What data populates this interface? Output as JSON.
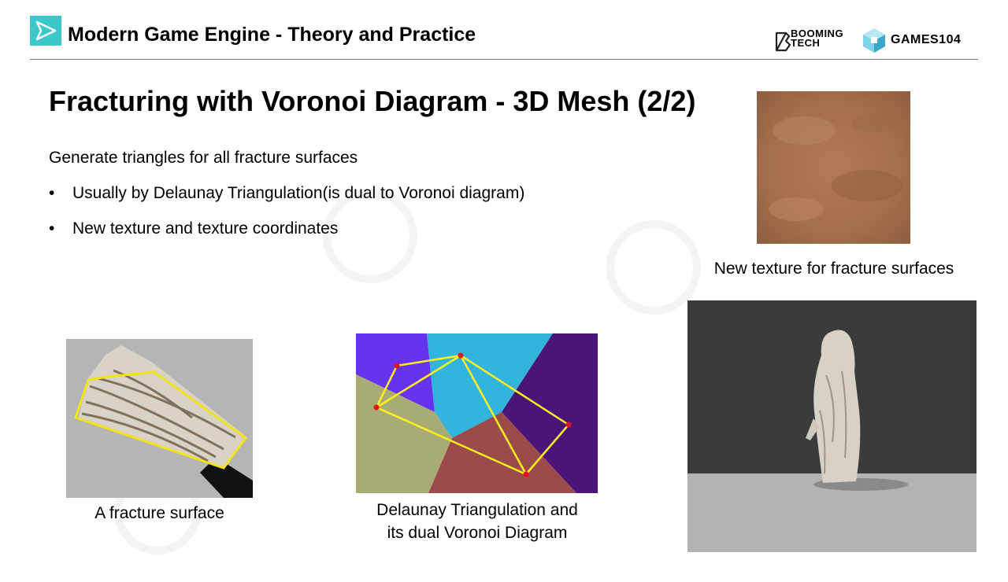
{
  "header": {
    "title": "Modern Game Engine - Theory and Practice",
    "logos": {
      "booming_tech": "BOOMING TECH",
      "games104": "GAMES104"
    }
  },
  "slide": {
    "title": "Fracturing with Voronoi Diagram - 3D Mesh (2/2)",
    "intro": "Generate triangles for all fracture surfaces",
    "bullets": [
      "Usually by Delaunay Triangulation(is dual to Voronoi diagram)",
      "New texture and texture coordinates"
    ]
  },
  "figures": {
    "texture_caption": "New texture for fracture surfaces",
    "fracture_caption": "A fracture surface",
    "voronoi_caption_line1": "Delaunay Triangulation and",
    "voronoi_caption_line2": "its dual Voronoi Diagram"
  },
  "colors": {
    "accent_teal": "#3cc8c8",
    "delaunay_edge": "#ffee22",
    "site_point": "#e8101a",
    "voronoi_cells": [
      "#6633ee",
      "#33b4dc",
      "#4a1478",
      "#a8ac74",
      "#9c4a4a"
    ]
  }
}
